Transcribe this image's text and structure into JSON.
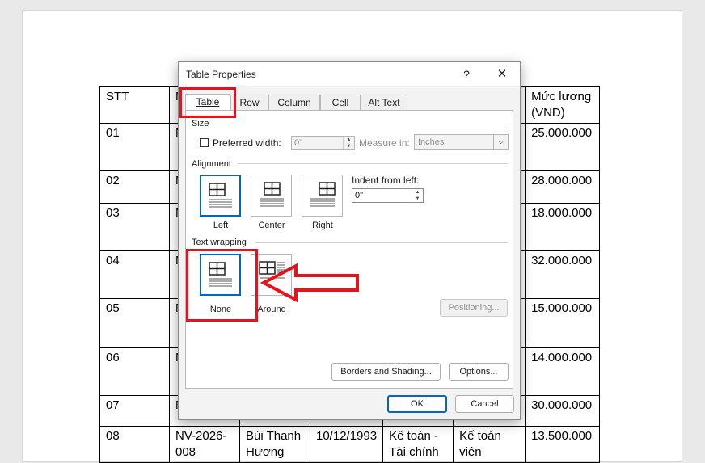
{
  "document": {
    "header_row": {
      "stt": "STT",
      "b": "M",
      "salary": "Mức lương (VNĐ)"
    },
    "rows": [
      {
        "stt": "01",
        "b": "N",
        "salary": "25.000.000"
      },
      {
        "stt": "02",
        "b": "N",
        "salary": "28.000.000"
      },
      {
        "stt": "03",
        "b": "N",
        "salary": "18.000.000"
      },
      {
        "stt": "04",
        "b": "N",
        "salary": "32.000.000"
      },
      {
        "stt": "05",
        "b": "N",
        "salary": "15.000.000"
      },
      {
        "stt": "06",
        "b": "N",
        "salary": "14.000.000"
      },
      {
        "stt": "07",
        "b": "N",
        "salary": "30.000.000"
      }
    ],
    "last_row": {
      "stt": "08",
      "code": "NV-2026-008",
      "name": "Bùi Thanh Hương",
      "dob": "10/12/1993",
      "dept": "Kế toán - Tài chính",
      "position": "Kế toán viên",
      "salary": "13.500.000"
    }
  },
  "dialog": {
    "title": "Table Properties",
    "help_glyph": "?",
    "close_glyph": "✕",
    "tabs": [
      {
        "label": "Table",
        "active": true
      },
      {
        "label": "Row",
        "active": false
      },
      {
        "label": "Column",
        "active": false
      },
      {
        "label": "Cell",
        "active": false
      },
      {
        "label": "Alt Text",
        "active": false
      }
    ],
    "size": {
      "group_label": "Size",
      "preferred_width_label": "Preferred width:",
      "preferred_width_value": "0\"",
      "measure_in_label": "Measure in:",
      "measure_in_value": "Inches"
    },
    "alignment": {
      "group_label": "Alignment",
      "options": [
        {
          "label": "Left",
          "selected": true
        },
        {
          "label": "Center",
          "selected": false
        },
        {
          "label": "Right",
          "selected": false
        }
      ],
      "indent_label": "Indent from left:",
      "indent_value": "0\""
    },
    "text_wrapping": {
      "group_label": "Text wrapping",
      "options": [
        {
          "label": "None",
          "selected": true
        },
        {
          "label": "Around",
          "selected": false
        }
      ],
      "positioning_label": "Positioning..."
    },
    "borders_label": "Borders and Shading...",
    "options_label": "Options...",
    "ok_label": "OK",
    "cancel_label": "Cancel"
  },
  "annotation_color": "#e8121c",
  "selection_color": "#0067c0"
}
